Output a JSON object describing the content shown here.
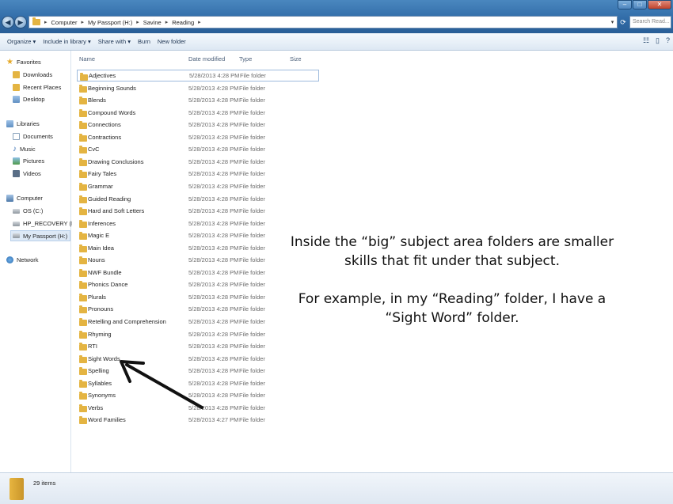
{
  "address": {
    "crumbs": [
      "Computer",
      "My Passport (H:)",
      "Savine",
      "Reading"
    ],
    "search_placeholder": "Search Read..."
  },
  "toolbar": {
    "organize": "Organize ▾",
    "include": "Include in library ▾",
    "share": "Share with ▾",
    "burn": "Burn",
    "new_folder": "New folder"
  },
  "nav": {
    "favorites": "Favorites",
    "downloads": "Downloads",
    "recent": "Recent Places",
    "desktop": "Desktop",
    "libraries": "Libraries",
    "documents": "Documents",
    "music": "Music",
    "pictures": "Pictures",
    "videos": "Videos",
    "computer": "Computer",
    "os": "OS (C:)",
    "recovery": "HP_RECOVERY (D:)",
    "passport": "My Passport (H:)",
    "network": "Network"
  },
  "columns": {
    "name": "Name",
    "date": "Date modified",
    "type": "Type",
    "size": "Size"
  },
  "files": [
    {
      "name": "Adjectives",
      "date": "5/28/2013 4:28 PM",
      "type": "File folder"
    },
    {
      "name": "Beginning Sounds",
      "date": "5/28/2013 4:28 PM",
      "type": "File folder"
    },
    {
      "name": "Blends",
      "date": "5/28/2013 4:28 PM",
      "type": "File folder"
    },
    {
      "name": "Compound Words",
      "date": "5/28/2013 4:28 PM",
      "type": "File folder"
    },
    {
      "name": "Connections",
      "date": "5/28/2013 4:28 PM",
      "type": "File folder"
    },
    {
      "name": "Contractions",
      "date": "5/28/2013 4:28 PM",
      "type": "File folder"
    },
    {
      "name": "CvC",
      "date": "5/28/2013 4:28 PM",
      "type": "File folder"
    },
    {
      "name": "Drawing Conclusions",
      "date": "5/28/2013 4:28 PM",
      "type": "File folder"
    },
    {
      "name": "Fairy Tales",
      "date": "5/28/2013 4:28 PM",
      "type": "File folder"
    },
    {
      "name": "Grammar",
      "date": "5/28/2013 4:28 PM",
      "type": "File folder"
    },
    {
      "name": "Guided Reading",
      "date": "5/28/2013 4:28 PM",
      "type": "File folder"
    },
    {
      "name": "Hard and Soft Letters",
      "date": "5/28/2013 4:28 PM",
      "type": "File folder"
    },
    {
      "name": "Inferences",
      "date": "5/28/2013 4:28 PM",
      "type": "File folder"
    },
    {
      "name": "Magic E",
      "date": "5/28/2013 4:28 PM",
      "type": "File folder"
    },
    {
      "name": "Main Idea",
      "date": "5/28/2013 4:28 PM",
      "type": "File folder"
    },
    {
      "name": "Nouns",
      "date": "5/28/2013 4:28 PM",
      "type": "File folder"
    },
    {
      "name": "NWF Bundle",
      "date": "5/28/2013 4:28 PM",
      "type": "File folder"
    },
    {
      "name": "Phonics Dance",
      "date": "5/28/2013 4:28 PM",
      "type": "File folder"
    },
    {
      "name": "Plurals",
      "date": "5/28/2013 4:28 PM",
      "type": "File folder"
    },
    {
      "name": "Pronouns",
      "date": "5/28/2013 4:28 PM",
      "type": "File folder"
    },
    {
      "name": "Retelling and Comprehension",
      "date": "5/28/2013 4:28 PM",
      "type": "File folder"
    },
    {
      "name": "Rhyming",
      "date": "5/28/2013 4:28 PM",
      "type": "File folder"
    },
    {
      "name": "RTI",
      "date": "5/28/2013 4:28 PM",
      "type": "File folder"
    },
    {
      "name": "Sight Words",
      "date": "5/28/2013 4:28 PM",
      "type": "File folder"
    },
    {
      "name": "Spelling",
      "date": "5/28/2013 4:28 PM",
      "type": "File folder"
    },
    {
      "name": "Syllables",
      "date": "5/28/2013 4:28 PM",
      "type": "File folder"
    },
    {
      "name": "Synonyms",
      "date": "5/28/2013 4:28 PM",
      "type": "File folder"
    },
    {
      "name": "Verbs",
      "date": "5/28/2013 4:28 PM",
      "type": "File folder"
    },
    {
      "name": "Word Families",
      "date": "5/28/2013 4:27 PM",
      "type": "File folder"
    }
  ],
  "annotation": {
    "line1": "Inside the “big” subject area folders are smaller skills that fit under that subject.",
    "line2": "For example, in my “Reading” folder, I have a “Sight Word” folder."
  },
  "status": {
    "count": "29 items"
  }
}
